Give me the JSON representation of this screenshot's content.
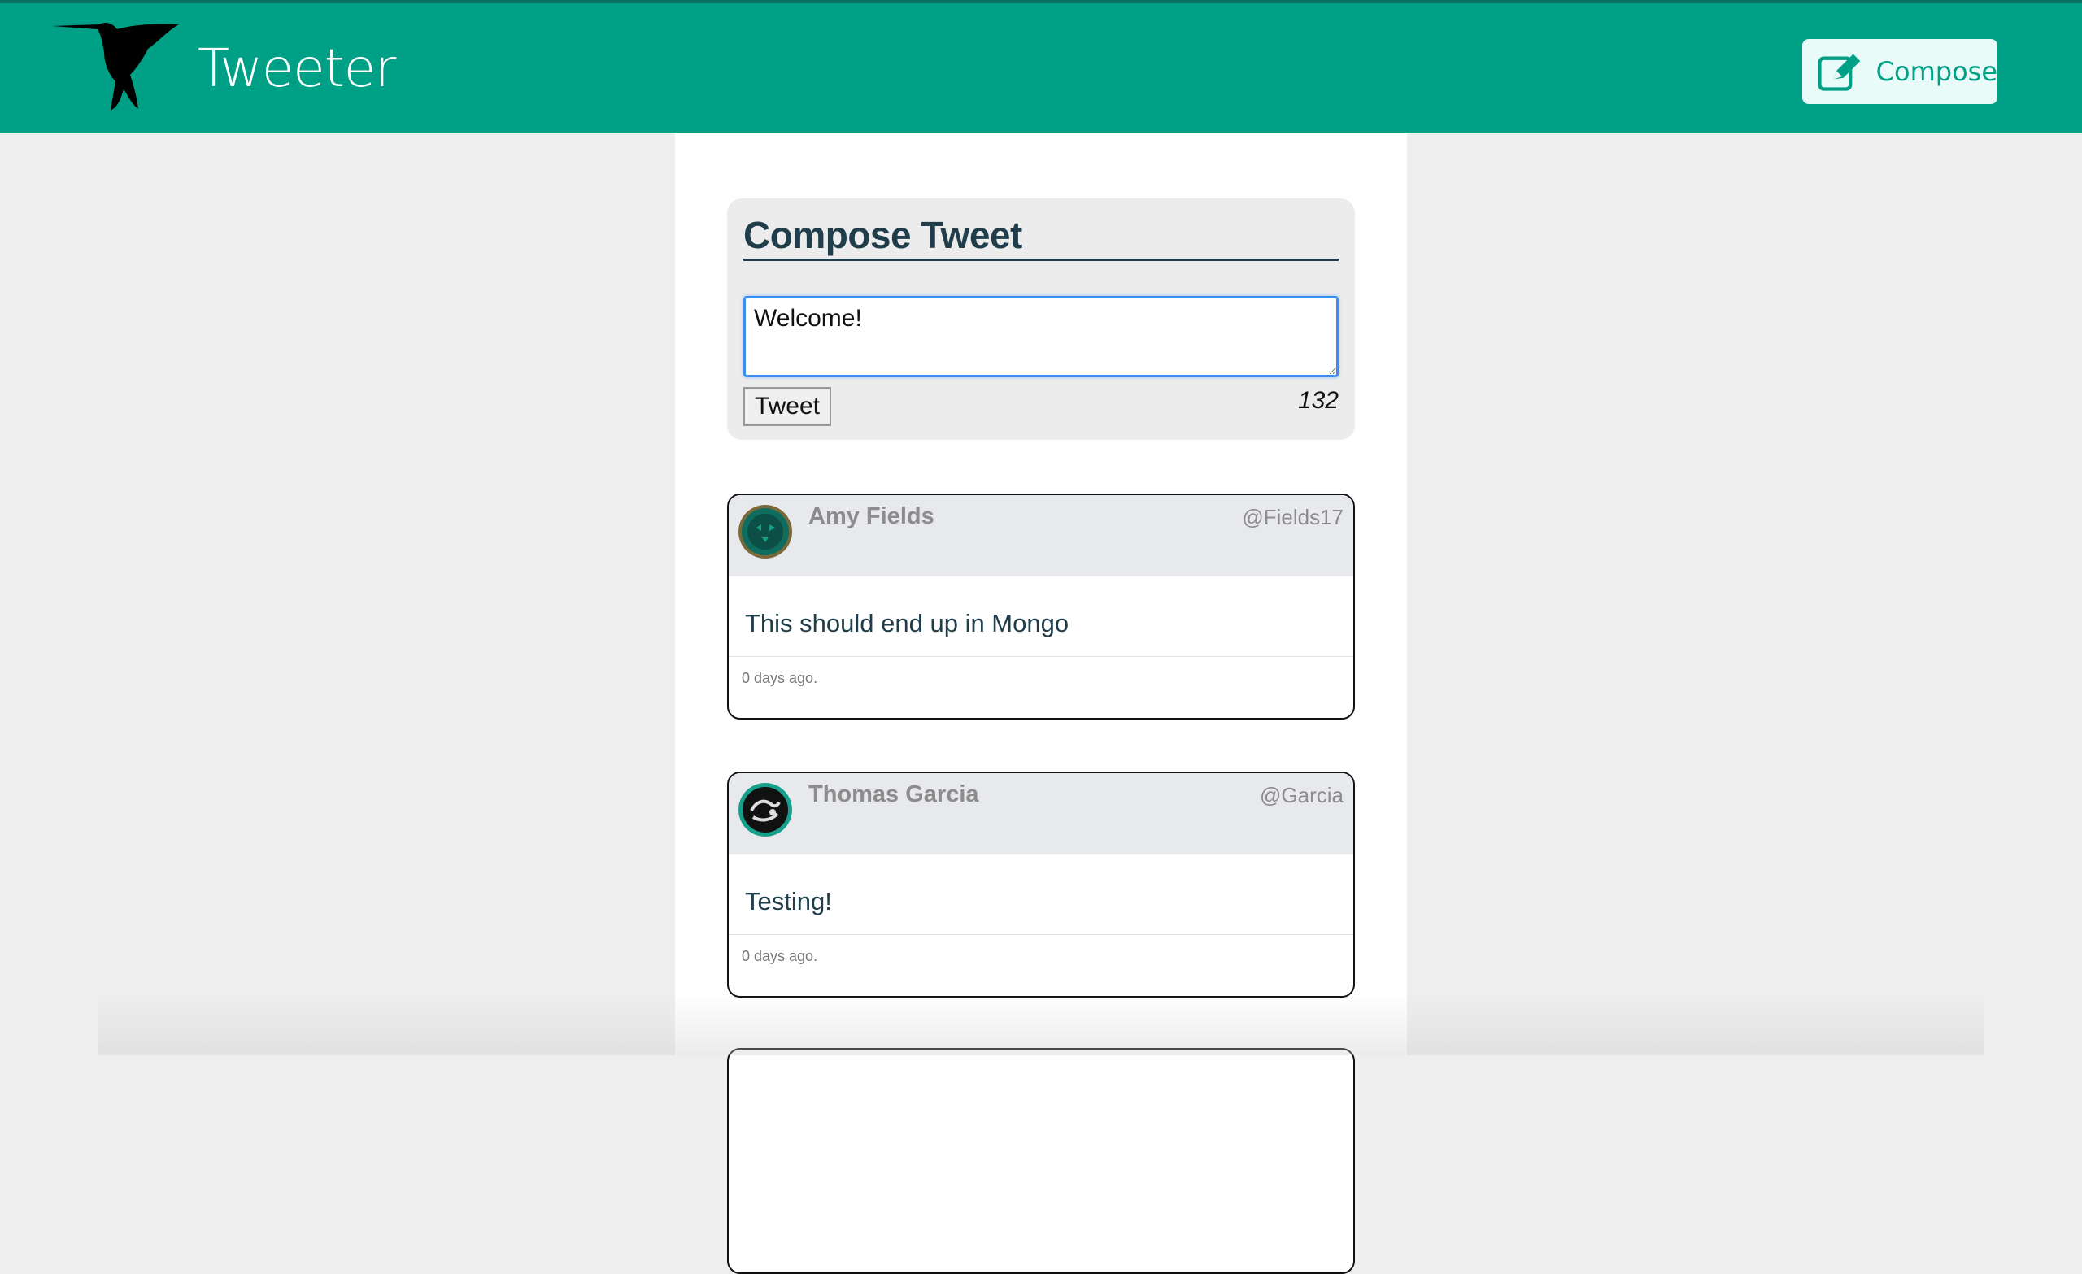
{
  "header": {
    "brand": "Tweeter",
    "compose_label": "Compose",
    "logo_icon": "hummingbird-logo",
    "compose_icon": "pencil-square-icon"
  },
  "compose": {
    "title": "Compose Tweet",
    "input_value": "Welcome!",
    "submit_label": "Tweet",
    "counter": "132"
  },
  "tweets": [
    {
      "name": "Amy Fields",
      "handle": "@Fields17",
      "text": "This should end up in Mongo",
      "time": "0 days ago."
    },
    {
      "name": "Thomas Garcia",
      "handle": "@Garcia",
      "text": "Testing!",
      "time": "0 days ago."
    }
  ],
  "colors": {
    "header_bg": "#00a087",
    "accent": "#00a087",
    "title_text": "#1f3d4a",
    "page_bg": "#eeeeee"
  }
}
